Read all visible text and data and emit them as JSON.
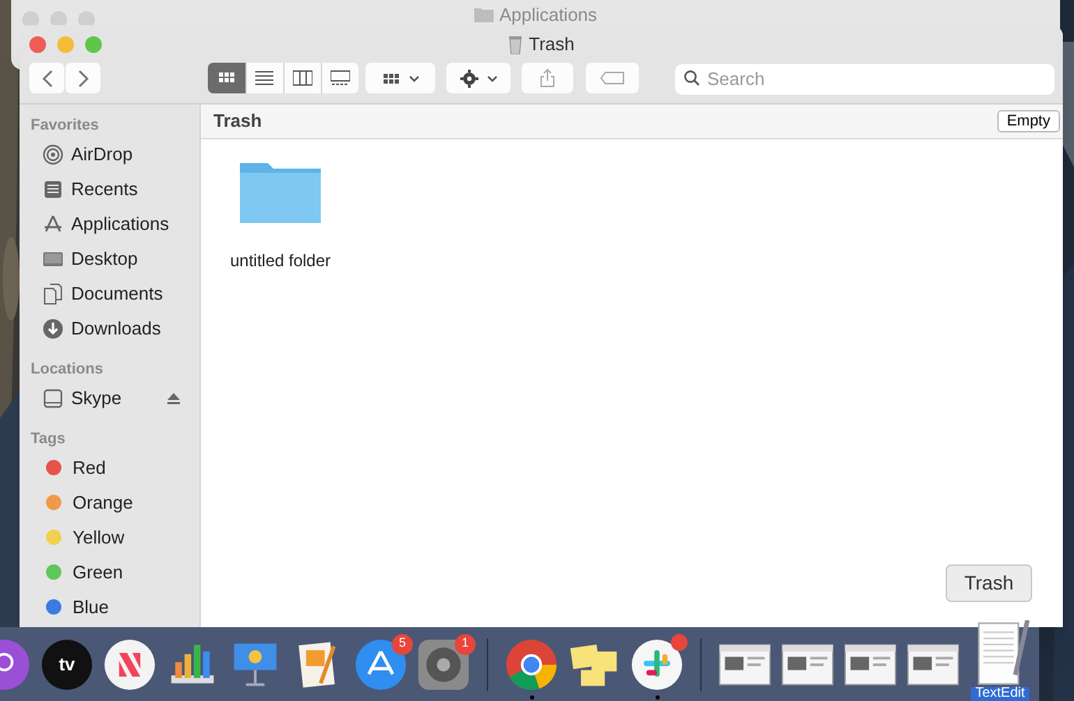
{
  "background_window": {
    "title": "Applications"
  },
  "window": {
    "title": "Trash"
  },
  "toolbar": {
    "view_modes": [
      {
        "kind": "icons",
        "selected": true
      },
      {
        "kind": "list",
        "selected": false
      },
      {
        "kind": "columns",
        "selected": false
      },
      {
        "kind": "gallery",
        "selected": false
      }
    ],
    "search": {
      "placeholder": "Search"
    }
  },
  "sidebar": {
    "sections": [
      {
        "heading": "Favorites",
        "items": [
          {
            "label": "AirDrop",
            "kind": "airdrop"
          },
          {
            "label": "Recents",
            "kind": "recents"
          },
          {
            "label": "Applications",
            "kind": "applications"
          },
          {
            "label": "Desktop",
            "kind": "desktop"
          },
          {
            "label": "Documents",
            "kind": "documents"
          },
          {
            "label": "Downloads",
            "kind": "downloads"
          }
        ]
      },
      {
        "heading": "Locations",
        "items": [
          {
            "label": "Skype",
            "kind": "drive",
            "ejectable": true
          }
        ]
      },
      {
        "heading": "Tags",
        "items": [
          {
            "label": "Red",
            "kind": "tag",
            "color": "#e5534b"
          },
          {
            "label": "Orange",
            "kind": "tag",
            "color": "#ef9a48"
          },
          {
            "label": "Yellow",
            "kind": "tag",
            "color": "#f3cf4f"
          },
          {
            "label": "Green",
            "kind": "tag",
            "color": "#5fc65a"
          },
          {
            "label": "Blue",
            "kind": "tag",
            "color": "#3a7be0"
          }
        ]
      }
    ]
  },
  "content": {
    "path_title": "Trash",
    "empty_button": "Empty",
    "items": [
      {
        "name": "untitled folder",
        "kind": "folder"
      }
    ]
  },
  "tooltip": "Trash",
  "dock": {
    "items": [
      {
        "kind": "podcasts",
        "running": false
      },
      {
        "kind": "tv",
        "icon_text": "tv",
        "running": false
      },
      {
        "kind": "news",
        "running": false
      },
      {
        "kind": "numbers",
        "running": false
      },
      {
        "kind": "keynote",
        "running": false
      },
      {
        "kind": "pages",
        "running": false
      },
      {
        "kind": "appstore",
        "badge": "5",
        "running": false
      },
      {
        "kind": "settings",
        "badge": "1",
        "running": false
      },
      {
        "kind": "separator"
      },
      {
        "kind": "chrome",
        "running": true
      },
      {
        "kind": "stickies",
        "running": false
      },
      {
        "kind": "slack",
        "badge_dot": true,
        "running": true
      },
      {
        "kind": "separator"
      },
      {
        "kind": "window_thumbnail",
        "running": false
      },
      {
        "kind": "window_thumbnail",
        "running": false
      },
      {
        "kind": "window_thumbnail",
        "running": false
      },
      {
        "kind": "window_thumbnail",
        "running": false
      },
      {
        "kind": "textedit",
        "label": "TextEdit",
        "running": false
      }
    ]
  }
}
